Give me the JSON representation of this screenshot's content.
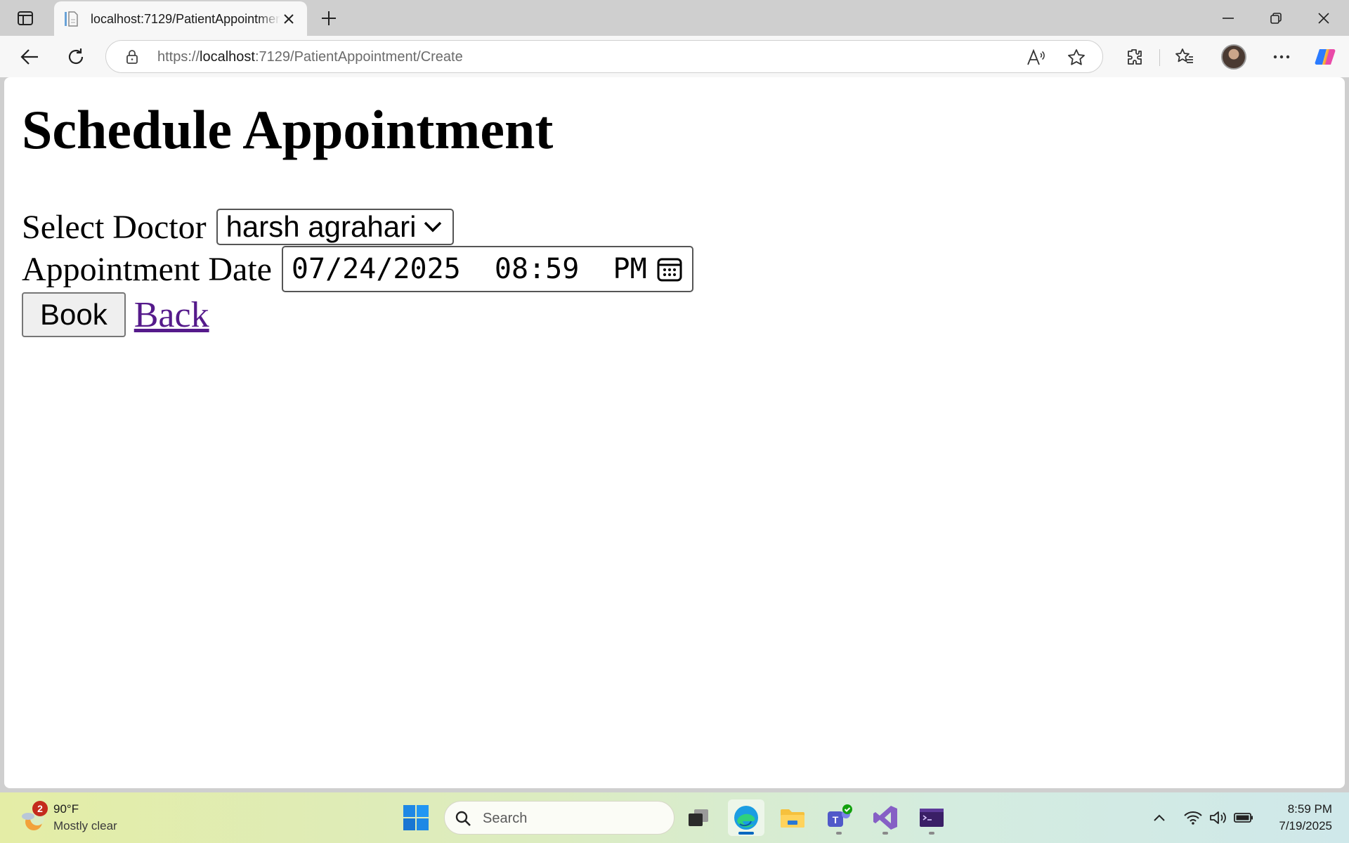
{
  "browser": {
    "tab_title": "localhost:7129/PatientAppointment/Create",
    "url_scheme": "https://",
    "url_host": "localhost",
    "url_rest": ":7129/PatientAppointment/Create"
  },
  "page": {
    "heading": "Schedule Appointment",
    "doctor_label": "Select Doctor",
    "doctor_selected": "harsh agrahari",
    "date_label": "Appointment Date",
    "date_value": "07/24/2025  08:59  PM",
    "book_label": "Book",
    "back_label": "Back"
  },
  "taskbar": {
    "weather_badge": "2",
    "weather_temp": "90°F",
    "weather_desc": "Mostly clear",
    "search_placeholder": "Search",
    "clock_time": "8:59 PM",
    "clock_date": "7/19/2025"
  },
  "colors": {
    "link_visited": "#551a8b",
    "button_bg": "#efefef",
    "taskbar_accent": "#0067c0"
  }
}
